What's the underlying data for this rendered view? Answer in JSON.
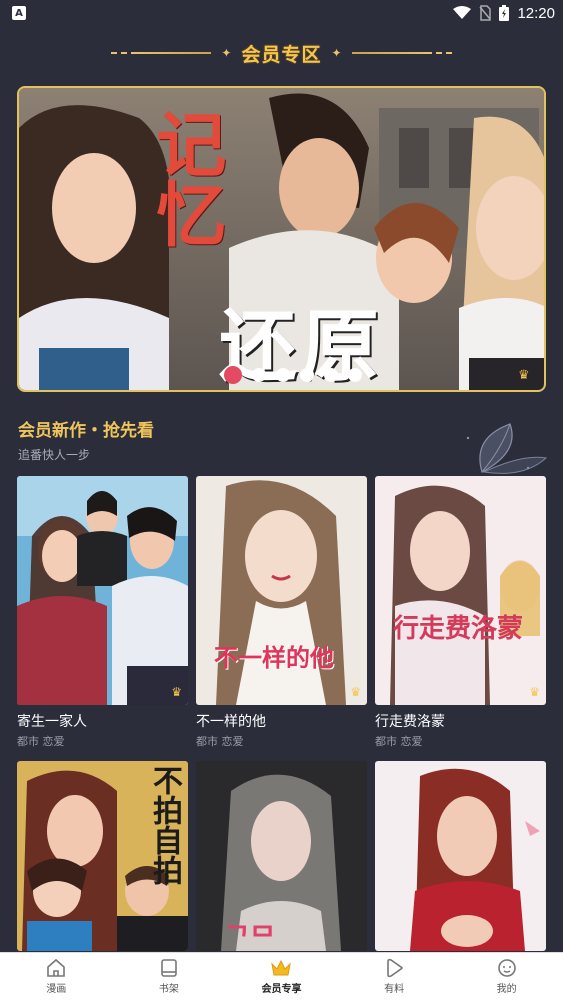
{
  "status": {
    "time": "12:20",
    "app_icon": "A"
  },
  "section": {
    "title": "会员专区"
  },
  "banner": {
    "title_line1": "记忆",
    "title_line2": "还原",
    "dot_count": 6,
    "active_dot": 0
  },
  "new_section": {
    "title": "会员新作・抢先看",
    "subtitle": "追番快人一步"
  },
  "comics": [
    {
      "title": "寄生一家人",
      "tags": "都市 恋爱",
      "cover_text": ""
    },
    {
      "title": "不一样的他",
      "tags": "都市 恋爱",
      "cover_text": "不一样的他"
    },
    {
      "title": "行走费洛蒙",
      "tags": "都市 恋爱",
      "cover_text": "行走费洛蒙"
    },
    {
      "title": "",
      "tags": "",
      "cover_text": "不拍自拍"
    },
    {
      "title": "",
      "tags": "",
      "cover_text": ""
    },
    {
      "title": "",
      "tags": "",
      "cover_text": ""
    }
  ],
  "nav": [
    {
      "label": "漫画",
      "icon": "home-icon"
    },
    {
      "label": "书架",
      "icon": "bookshelf-icon"
    },
    {
      "label": "会员专享",
      "icon": "crown-icon"
    },
    {
      "label": "有料",
      "icon": "play-icon"
    },
    {
      "label": "我的",
      "icon": "profile-icon"
    }
  ],
  "colors": {
    "background": "#2b2d3b",
    "gold": "#f4c64e",
    "accent": "#e24b62"
  }
}
